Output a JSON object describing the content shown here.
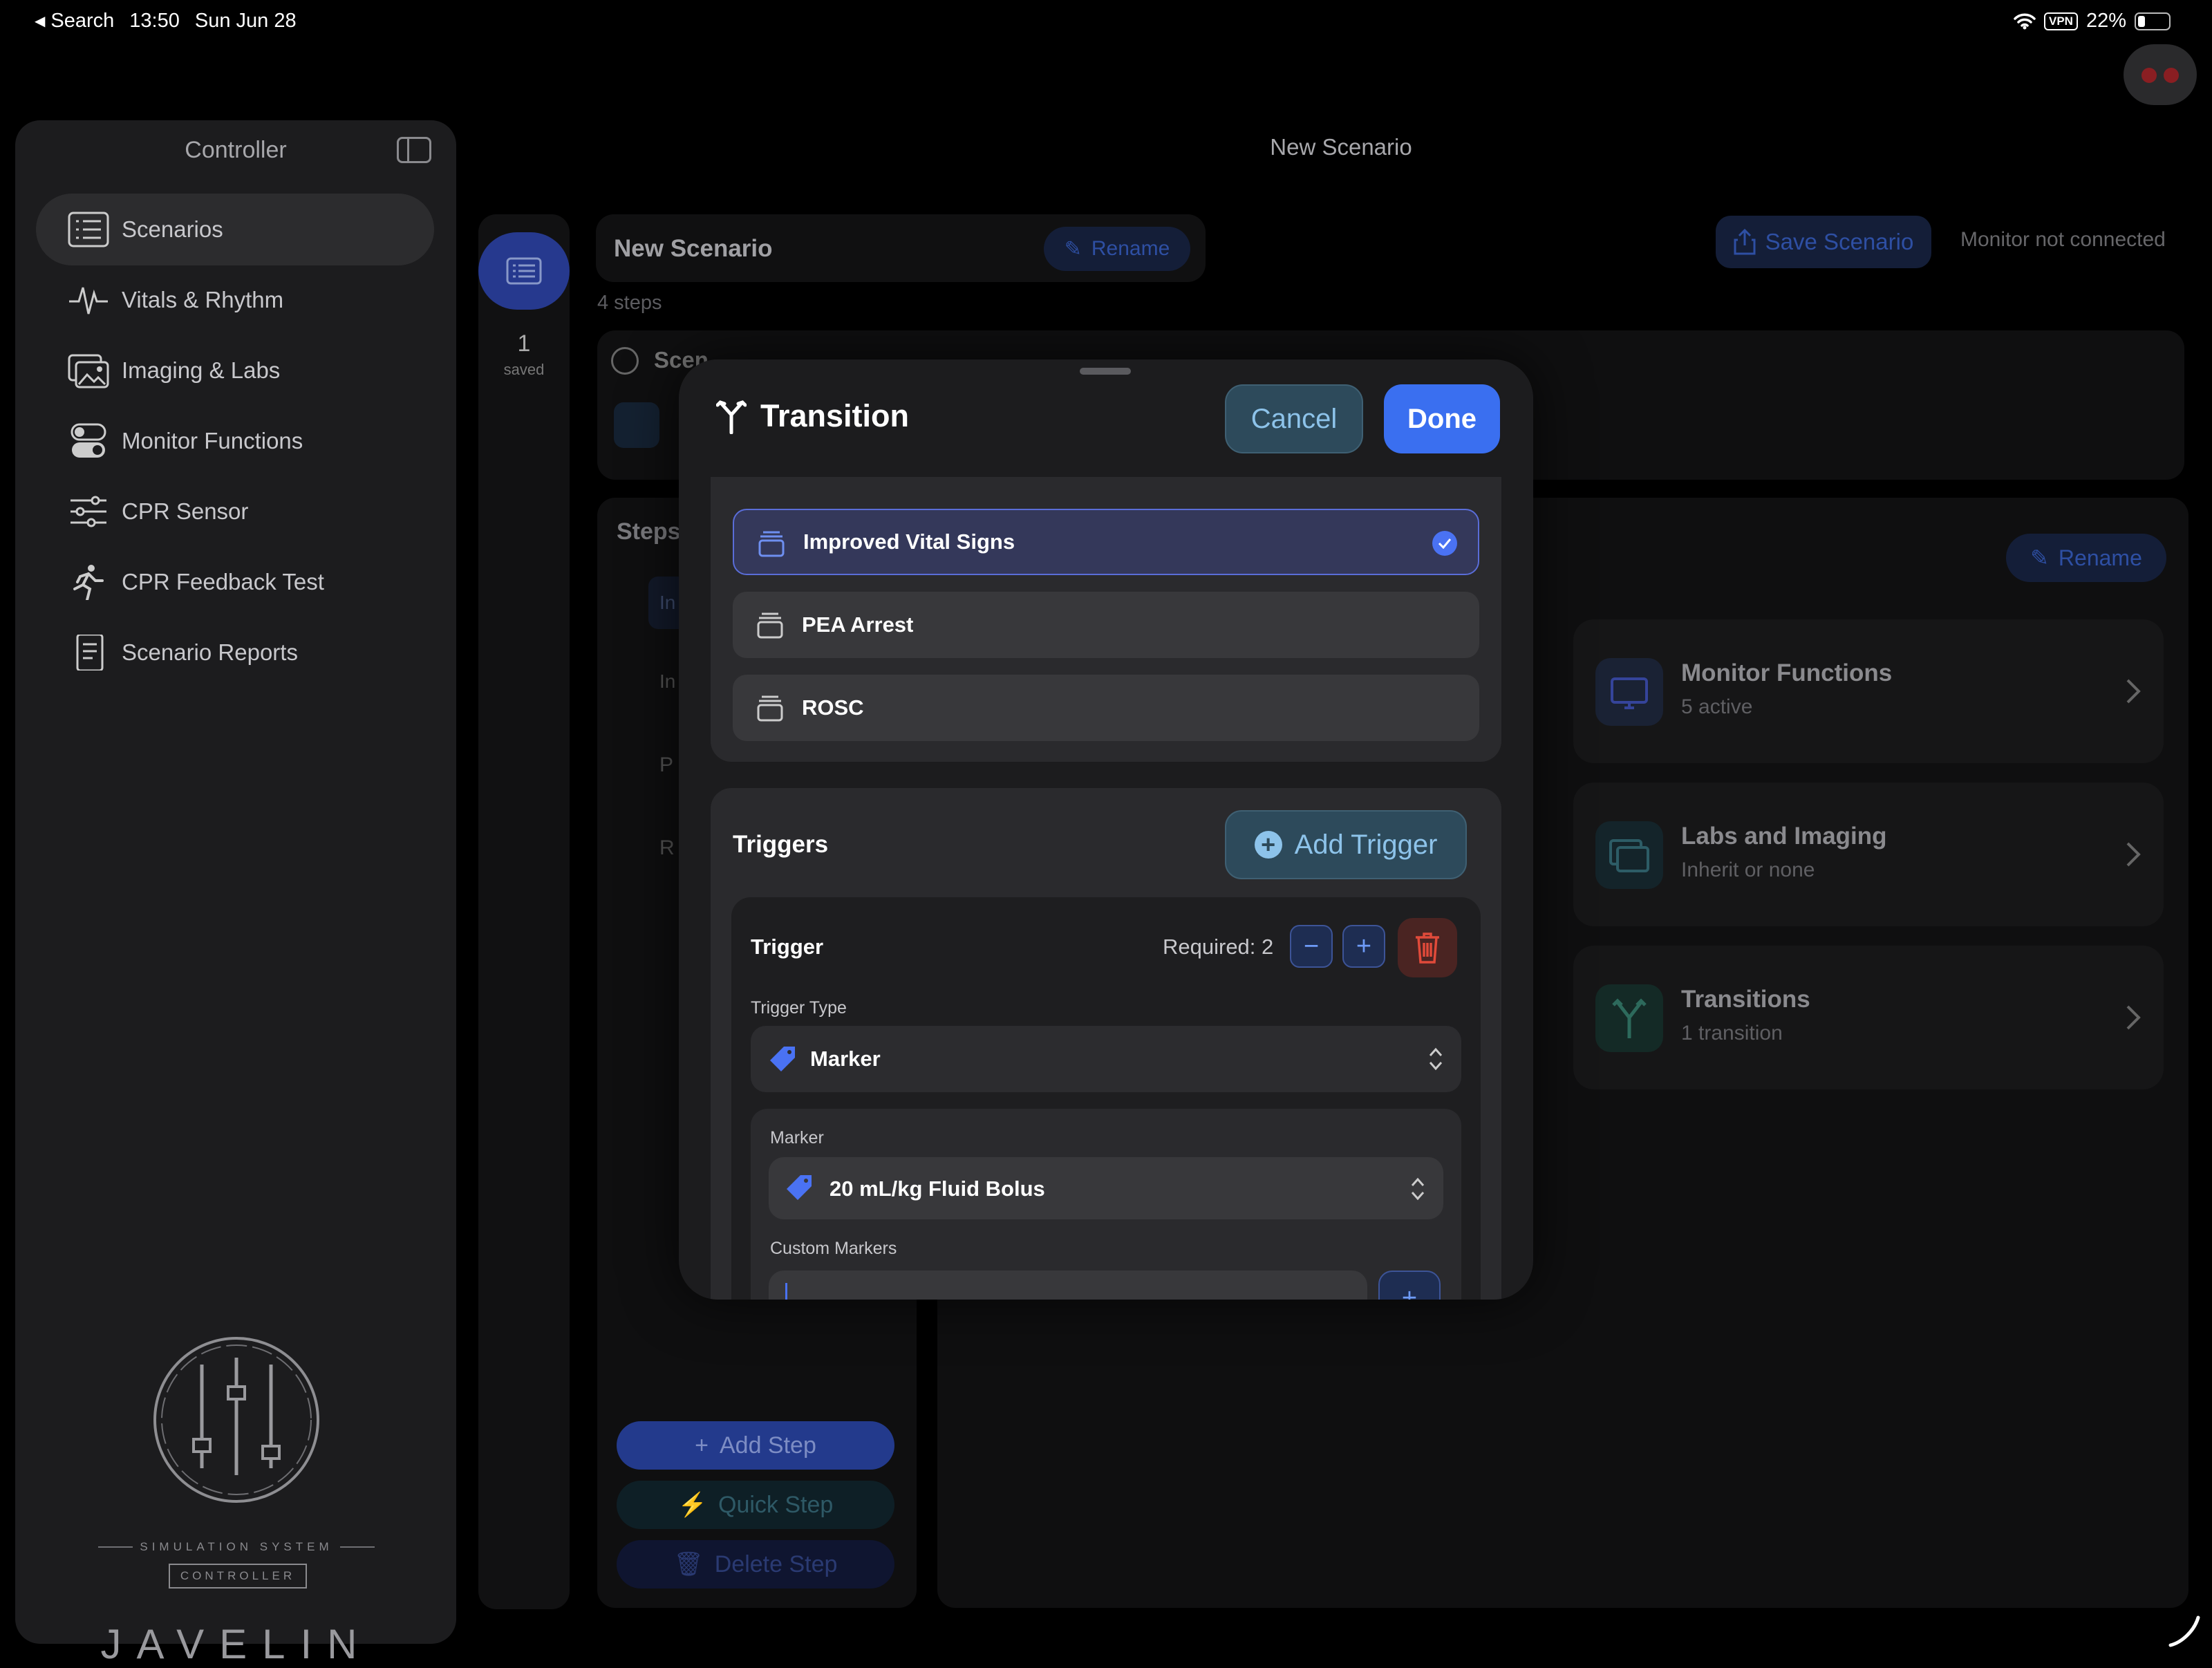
{
  "status_bar": {
    "back_label": "Search",
    "time": "13:50",
    "date": "Sun Jun 28",
    "vpn": "VPN",
    "battery": "22%"
  },
  "sidebar": {
    "title": "Controller",
    "items": [
      {
        "label": "Scenarios",
        "icon": "list-icon",
        "selected": true
      },
      {
        "label": "Vitals & Rhythm",
        "icon": "waveform-icon"
      },
      {
        "label": "Imaging & Labs",
        "icon": "photos-icon"
      },
      {
        "label": "Monitor Functions",
        "icon": "toggles-icon"
      },
      {
        "label": "CPR Sensor",
        "icon": "sliders-icon"
      },
      {
        "label": "CPR Feedback Test",
        "icon": "running-figure-icon"
      },
      {
        "label": "Scenario Reports",
        "icon": "document-icon"
      }
    ],
    "logo": {
      "word": "JAVELIN",
      "tagline": "SIMULATION SYSTEM",
      "badge": "CONTROLLER"
    }
  },
  "main": {
    "title": "New Scenario",
    "rail": {
      "count": "1",
      "count_label": "saved"
    },
    "scenario_name": "New Scenario",
    "rename_label": "Rename",
    "steps_count": "4 steps",
    "save_label": "Save Scenario",
    "monitor_status": "Monitor not connected",
    "scen_label": "Scen",
    "steps_label": "Steps",
    "step_letters": [
      "In",
      "In",
      "P",
      "R"
    ],
    "rename2_label": "Rename",
    "cards": [
      {
        "title": "Monitor Functions",
        "subtitle": "5 active",
        "icon": "monitor-icon"
      },
      {
        "title": "Labs and Imaging",
        "subtitle": "Inherit or none",
        "icon": "photos-icon"
      },
      {
        "title": "Transitions",
        "subtitle": "1 transition",
        "icon": "branch-icon"
      }
    ],
    "add_step": "Add Step",
    "quick_step": "Quick Step",
    "delete_step": "Delete Step"
  },
  "modal": {
    "title": "Transition",
    "cancel": "Cancel",
    "done": "Done",
    "options": [
      {
        "label": "Improved Vital Signs",
        "selected": true
      },
      {
        "label": "PEA Arrest",
        "selected": false
      },
      {
        "label": "ROSC",
        "selected": false
      }
    ],
    "triggers": {
      "heading": "Triggers",
      "add_label": "Add Trigger",
      "trigger_title": "Trigger",
      "required_label": "Required: 2",
      "type_label": "Trigger Type",
      "type_value": "Marker",
      "marker_label": "Marker",
      "marker_value": "20 mL/kg Fluid Bolus",
      "custom_label": "Custom Markers"
    }
  },
  "colors": {
    "accent": "#3a6ff0",
    "cancel_text": "#8dc3ea",
    "delete": "#e04a3a"
  }
}
